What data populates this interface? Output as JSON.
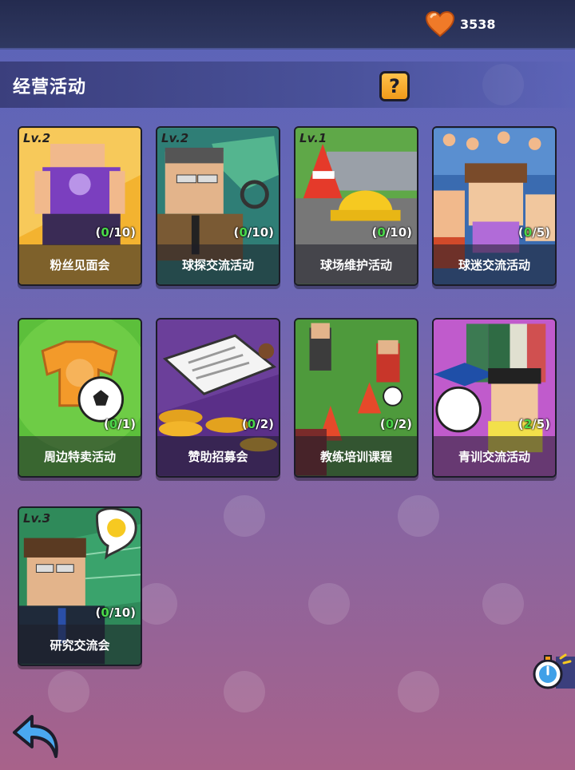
{
  "currency": {
    "icon": "heart-icon",
    "amount": "3538"
  },
  "header": {
    "title": "经营活动",
    "help": "?"
  },
  "cards": [
    {
      "name": "粉丝见面会",
      "level": "Lv.2",
      "current": "0",
      "max": "10",
      "bg": "#f4b534"
    },
    {
      "name": "球探交流活动",
      "level": "Lv.2",
      "current": "0",
      "max": "10",
      "bg": "#3d8f83"
    },
    {
      "name": "球场维护活动",
      "level": "Lv.1",
      "current": "0",
      "max": "10",
      "bg": "#6aa84f"
    },
    {
      "name": "球迷交流活动",
      "level": "",
      "current": "0",
      "max": "5",
      "bg": "#3a6bb0"
    },
    {
      "name": "周边特卖活动",
      "level": "",
      "current": "0",
      "max": "1",
      "bg": "#5cbf3b"
    },
    {
      "name": "赞助招募会",
      "level": "",
      "current": "0",
      "max": "2",
      "bg": "#6b3f9a"
    },
    {
      "name": "教练培训课程",
      "level": "",
      "current": "0",
      "max": "2",
      "bg": "#4e9a3c"
    },
    {
      "name": "青训交流活动",
      "level": "",
      "current": "2",
      "max": "5",
      "bg": "#c05bcc"
    },
    {
      "name": "研究交流会",
      "level": "Lv.3",
      "current": "0",
      "max": "10",
      "bg": "#2f8a5a"
    }
  ],
  "colors": {
    "accent": "#f19a1a",
    "count_current": "#4bd84b"
  }
}
